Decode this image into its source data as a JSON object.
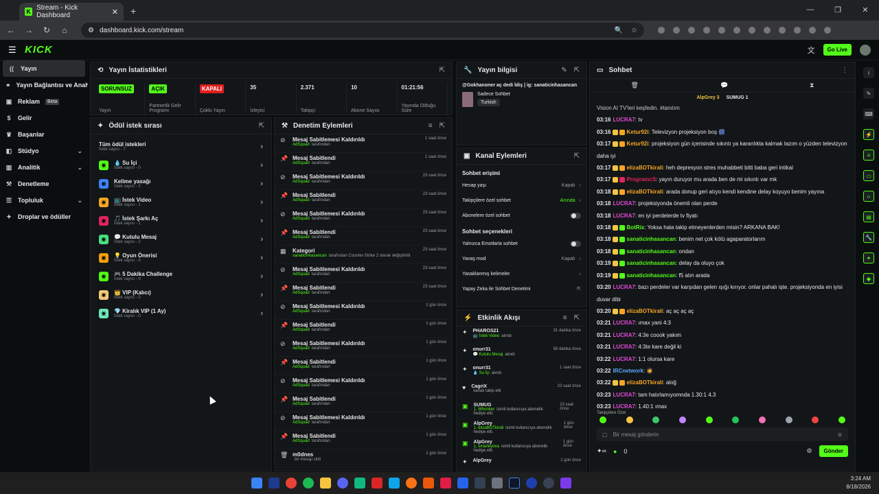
{
  "browser": {
    "tab_title": "Stream - Kick Dashboard",
    "url": "dashboard.kick.com/stream"
  },
  "topbar": {
    "logo": "KICK",
    "go_live": "Go Live"
  },
  "sidebar": {
    "items": [
      {
        "label": "Yayın",
        "icon": "broadcast-icon",
        "active": true
      },
      {
        "label": "Yayın Bağlantısı ve Anahtarı",
        "icon": "link-icon"
      },
      {
        "label": "Reklam",
        "icon": "ad-icon",
        "badge": "Beta"
      },
      {
        "label": "Gelir",
        "icon": "money-icon"
      },
      {
        "label": "Başarılar",
        "icon": "trophy-icon"
      },
      {
        "label": "Stüdyo",
        "icon": "studio-icon",
        "expand": true
      },
      {
        "label": "Analitik",
        "icon": "chart-icon",
        "expand": true
      },
      {
        "label": "Denetleme",
        "icon": "hammer-icon"
      },
      {
        "label": "Topluluk",
        "icon": "community-icon",
        "expand": true
      },
      {
        "label": "Droplar ve ödüller",
        "icon": "gift-icon"
      }
    ]
  },
  "stats": {
    "title": "Yayın İstatistikleri",
    "items": [
      {
        "value": "SORUNSUZ",
        "label": "Yayın",
        "badge": "green"
      },
      {
        "value": "AÇIK",
        "label": "Partnerlik Gelir Programı",
        "badge": "green"
      },
      {
        "value": "KAPALI",
        "label": "Çoklu Yayın",
        "badge": "red"
      },
      {
        "value": "35",
        "label": "İzleyici"
      },
      {
        "value": "2.371",
        "label": "Takipçi"
      },
      {
        "value": "10",
        "label": "Abone Sayısı"
      },
      {
        "value": "01:21:56",
        "label": "Yayında Olduğu Süre"
      }
    ]
  },
  "rewards": {
    "title": "Ödül istek sırası",
    "items": [
      {
        "name": "Tüm ödül istekleri",
        "sub": "İstek sayısı - 7",
        "color": "#131618"
      },
      {
        "name": "💧 Su İçi",
        "sub": "İstek sayısı - 0",
        "color": "#53fc18"
      },
      {
        "name": "Kelime yasağı",
        "sub": "İstek sayısı - 2",
        "color": "#3b82f6"
      },
      {
        "name": "📺 İstek Video",
        "sub": "İstek sayısı - 1",
        "color": "#f5a623"
      },
      {
        "name": "🎵 İstek Şarkı Aç",
        "sub": "İstek sayısı - 1",
        "color": "#e0245e"
      },
      {
        "name": "💬 Kutulu Mesaj",
        "sub": "İstek sayısı - 2",
        "color": "#4ade80"
      },
      {
        "name": "💡 Oyun Önerisi",
        "sub": "İstek sayısı - 0",
        "color": "#f59e0b"
      },
      {
        "name": "🎮 5 Dakika Challenge",
        "sub": "İstek sayısı - 0",
        "color": "#53fc18"
      },
      {
        "name": "👑 VIP (Kalıcı)",
        "sub": "İstek sayısı - 0",
        "color": "#f5c97a"
      },
      {
        "name": "💎 Kiralık VIP (1 Ay)",
        "sub": "İstek sayısı - 0",
        "color": "#6ee7b7"
      }
    ]
  },
  "moderation": {
    "title": "Denetim Eylemleri",
    "items": [
      {
        "a": "Mesaj Sabitlemesi Kaldırıldı",
        "by": "AdSquad",
        "b": "tarafından",
        "t": "1 saat önce"
      },
      {
        "a": "Mesaj Sabitlendi",
        "by": "AdSquad",
        "b": "tarafından",
        "t": "1 saat önce"
      },
      {
        "a": "Mesaj Sabitlemesi Kaldırıldı",
        "by": "AdSquad",
        "b": "tarafından",
        "t": "23 saat önce"
      },
      {
        "a": "Mesaj Sabitlendi",
        "by": "AdSquad",
        "b": "tarafından",
        "t": "23 saat önce"
      },
      {
        "a": "Mesaj Sabitlemesi Kaldırıldı",
        "by": "AdSquad",
        "b": "tarafından",
        "t": "23 saat önce"
      },
      {
        "a": "Mesaj Sabitlendi",
        "by": "AdSquad",
        "b": "tarafından",
        "t": "23 saat önce"
      },
      {
        "a": "Kategori",
        "by": "sanaticinhasancan",
        "b": "tarafından Counter-Strike 2 olarak değiştirildi",
        "t": "23 saat önce"
      },
      {
        "a": "Mesaj Sabitlemesi Kaldırıldı",
        "by": "AdSquad",
        "b": "tarafından",
        "t": "23 saat önce"
      },
      {
        "a": "Mesaj Sabitlendi",
        "by": "AdSquad",
        "b": "tarafından",
        "t": "23 saat önce"
      },
      {
        "a": "Mesaj Sabitlemesi Kaldırıldı",
        "by": "AdSquad",
        "b": "tarafından",
        "t": "1 gün önce"
      },
      {
        "a": "Mesaj Sabitlendi",
        "by": "AdSquad",
        "b": "tarafından",
        "t": "1 gün önce"
      },
      {
        "a": "Mesaj Sabitlemesi Kaldırıldı",
        "by": "AdSquad",
        "b": "tarafından",
        "t": "1 gün önce"
      },
      {
        "a": "Mesaj Sabitlendi",
        "by": "AdSquad",
        "b": "tarafından",
        "t": "1 gün önce"
      },
      {
        "a": "Mesaj Sabitlemesi Kaldırıldı",
        "by": "AdSquad",
        "b": "tarafından",
        "t": "1 gün önce"
      },
      {
        "a": "Mesaj Sabitlendi",
        "by": "AdSquad",
        "b": "tarafından",
        "t": "1 gün önce"
      },
      {
        "a": "Mesaj Sabitlemesi Kaldırıldı",
        "by": "AdSquad",
        "b": "tarafından",
        "t": "1 gün önce"
      },
      {
        "a": "Mesaj Sabitlendi",
        "by": "AdSquad",
        "b": "tarafından",
        "t": "1 gün önce"
      },
      {
        "a": "m0dnes",
        "by": "",
        "b": "bir mesajı sildi",
        "t": "1 gün önce"
      }
    ]
  },
  "stream_info": {
    "title": "Yayın bilgisi",
    "stream_title": "@Gokhanoner aç dedi İdiş | ig: sanaticinhasancan",
    "category": "Sadece Sohbet",
    "tag": "Turkish"
  },
  "channel": {
    "title": "Kanal Eylemleri",
    "chat_access": "Sohbet erişimi",
    "rows": [
      {
        "label": "Hesap yaşı",
        "value": "Kapalı"
      },
      {
        "label": "Takipçilere özel sohbet",
        "value": "Anında"
      },
      {
        "label": "Abonelere özel sohbet",
        "value": ""
      }
    ],
    "chat_options": "Sohbet seçenekleri",
    "rows2": [
      {
        "label": "Yalnızca Emotlarla sohbet",
        "value": ""
      },
      {
        "label": "Yavaş mod",
        "value": "Kapalı"
      },
      {
        "label": "Yasaklanmış kelimeler",
        "value": ""
      },
      {
        "label": "Yapay Zeka ile Sohbet Denetimi",
        "value": ""
      }
    ]
  },
  "activity": {
    "title": "Etkinlik Akışı",
    "items": [
      {
        "a": "PHAROS21",
        "b": "📺 İstek Video",
        "c": "alındı",
        "t": "31 dakika önce"
      },
      {
        "a": "onurr31",
        "b": "💬 Kutulu Mesaj",
        "c": "alındı",
        "t": "58 dakika önce"
      },
      {
        "a": "onurr31",
        "b": "💧 Su İçi",
        "c": "alındı",
        "t": "1 saat önce"
      },
      {
        "a": "CagriX",
        "b": "",
        "c": "kanalı takip etti",
        "t": "23 saat önce"
      },
      {
        "a": "SUMUG",
        "b": "1, Whonker",
        "c": "isimli kullanıcıya abonelik hediye etti.",
        "t": "23 saat önce"
      },
      {
        "a": "AlpGrey",
        "b": "1, elizaBOTkirali",
        "c": "isimli kullanıcıya abonelik hediye etti.",
        "t": "1 gün önce"
      },
      {
        "a": "AlpGrey",
        "b": "1, smarleyova",
        "c": "isimli kullanıcıya abonelik hediye etti.",
        "t": "1 gün önce"
      },
      {
        "a": "AlpGrey",
        "b": "",
        "c": "",
        "t": "1 gün önce"
      }
    ]
  },
  "chat": {
    "title": "Sohbet",
    "gifters": [
      "AlpGrey 3",
      "SUMUG 1"
    ],
    "top_line": "Vision AI TV'leri keşfedin. #tanıtım",
    "messages": [
      {
        "t": "03:16",
        "u": "LUCRA7",
        "c": "#e24ad8",
        "m": "tv"
      },
      {
        "t": "03:16",
        "u": "Ketur92i",
        "c": "#f5a623",
        "m": "Televizyon projeksiyon boş 🎆"
      },
      {
        "t": "03:17",
        "u": "Ketur92i",
        "c": "#f5a623",
        "m": "projeksiyon gün içerisinde sıkıntı ya karanlıkta kalmak lazım o yüzden televizyon daha iyi"
      },
      {
        "t": "03:17",
        "u": "elizaBOTkirali",
        "c": "#f5a623",
        "m": "heh depresyon stres muhabbeti bitti baba geri intikal"
      },
      {
        "t": "03:17",
        "u": "ProgramcS",
        "c": "#e0245e",
        "m": "yayın duruyor mu arada ben de mi sıkıntı var mk"
      },
      {
        "t": "03:18",
        "u": "elizaBOTkirali",
        "c": "#f5a623",
        "m": "arada donup geri atıyo kendi kendine delay koyuyo benim yayına"
      },
      {
        "t": "03:18",
        "u": "LUCRA7",
        "c": "#e24ad8",
        "m": "projeksiyonda önemli olan perde"
      },
      {
        "t": "03:18",
        "u": "LUCRA7",
        "c": "#e24ad8",
        "m": "en iyi perdelerde tv fiyatı"
      },
      {
        "t": "03:18",
        "u": "BotRix",
        "c": "#53fc18",
        "m": "Yoksa hala takip etmeyenlerden misin? ARKANA BAK!"
      },
      {
        "t": "03:18",
        "u": "sanaticinhasancan",
        "c": "#53fc18",
        "m": "benim net çok kötü agaparatorlarım"
      },
      {
        "t": "03:18",
        "u": "sanaticinhasancan",
        "c": "#53fc18",
        "m": "ondan"
      },
      {
        "t": "03:19",
        "u": "sanaticinhasancan",
        "c": "#53fc18",
        "m": "delay da oluyo çok"
      },
      {
        "t": "03:19",
        "u": "sanaticinhasancan",
        "c": "#53fc18",
        "m": "f5 atın arada"
      },
      {
        "t": "03:20",
        "u": "LUCRA7",
        "c": "#e24ad8",
        "m": "bazı perdeler var karşıdan gelen ışığı kırıyor. onlar pahalı işte. projeksiyonda en iyisi duvar dibi"
      },
      {
        "t": "03:20",
        "u": "elizaBOTkirali",
        "c": "#f5a623",
        "m": "aç aç aç aç"
      },
      {
        "t": "03:21",
        "u": "LUCRA7",
        "c": "#e24ad8",
        "m": "ımax yani 4:3"
      },
      {
        "t": "03:21",
        "u": "LUCRA7",
        "c": "#e24ad8",
        "m": "4:3e coook yakım"
      },
      {
        "t": "03:21",
        "u": "LUCRA7",
        "c": "#e24ad8",
        "m": "4:3te kare değil ki"
      },
      {
        "t": "03:22",
        "u": "LUCRA7",
        "c": "#e24ad8",
        "m": "1:1 olursa kare"
      },
      {
        "t": "03:22",
        "u": "IRCnetwork",
        "c": "#60a5fa",
        "m": "🧔"
      },
      {
        "t": "03:22",
        "u": "elizaBOTkirali",
        "c": "#f5a623",
        "m": "aloğ"
      },
      {
        "t": "03:23",
        "u": "LUCRA7",
        "c": "#e24ad8",
        "m": "tam hatırlamıyomnda 1.30:1 4.3"
      },
      {
        "t": "03:23",
        "u": "LUCRA7",
        "c": "#e24ad8",
        "m": "1.40:1 ımax"
      }
    ],
    "followers_only": "Takipçilere Özel",
    "input_placeholder": "Bir mesaj gönderin",
    "viewer_count": "0",
    "send": "Gönder"
  },
  "taskbar": {
    "time": "3:24 AM",
    "date": "8/18/2026"
  }
}
